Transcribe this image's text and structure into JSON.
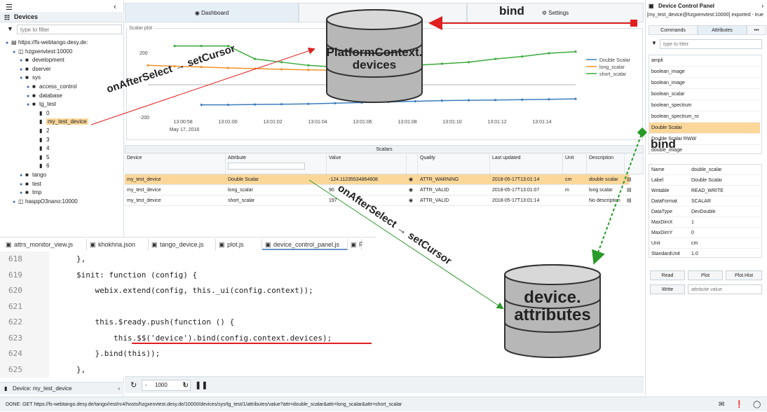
{
  "left": {
    "section_title": "Devices",
    "filter_placeholder": "type to filter",
    "tree": [
      {
        "label": "https://fs-webtango.desy.de:",
        "level": 0,
        "icon": "server-icon"
      },
      {
        "label": "hzgxenvtest:10000",
        "level": 1,
        "icon": "database-icon"
      },
      {
        "label": "development",
        "level": 2,
        "icon": "folder-icon"
      },
      {
        "label": "dserver",
        "level": 2,
        "icon": "folder-icon"
      },
      {
        "label": "sys",
        "level": 2,
        "icon": "folder-icon"
      },
      {
        "label": "access_control",
        "level": 3,
        "icon": "folder-icon"
      },
      {
        "label": "database",
        "level": 3,
        "icon": "folder-icon"
      },
      {
        "label": "tg_test",
        "level": 3,
        "icon": "folder-icon"
      },
      {
        "label": "0",
        "level": 4,
        "icon": "device-icon"
      },
      {
        "label": "my_test_device",
        "level": 4,
        "icon": "device-icon",
        "selected": true
      },
      {
        "label": "2",
        "level": 4,
        "icon": "device-icon"
      },
      {
        "label": "3",
        "level": 4,
        "icon": "device-icon"
      },
      {
        "label": "4",
        "level": 4,
        "icon": "device-icon"
      },
      {
        "label": "5",
        "level": 4,
        "icon": "device-icon"
      },
      {
        "label": "6",
        "level": 4,
        "icon": "device-icon"
      },
      {
        "label": "tango",
        "level": 2,
        "icon": "folder-icon"
      },
      {
        "label": "test",
        "level": 2,
        "icon": "folder-icon"
      },
      {
        "label": "tmp",
        "level": 2,
        "icon": "folder-icon"
      },
      {
        "label": "hasppO3nano:10000",
        "level": 1,
        "icon": "database-icon"
      }
    ],
    "footer": "Device: my_test_device"
  },
  "tabs": {
    "dashboard": "Dashboard",
    "settings": "Settings"
  },
  "plot": {
    "title": "Scalar plot",
    "scalars_bar": "Scalars"
  },
  "chart_data": {
    "type": "line",
    "title": "Scalar plot",
    "x_ticks": [
      "13:00:58",
      "13:01:00",
      "13:01:02",
      "13:01:04",
      "13:01:06",
      "13:01:08",
      "13:01:10",
      "13:01:12",
      "13:01:14"
    ],
    "x_date_label": "May 17, 2018",
    "y_ticks": [
      "200",
      "-200"
    ],
    "ylim": [
      -260,
      260
    ],
    "legend_position": "top-right",
    "series": [
      {
        "name": "Double Scalar",
        "color": "#3b7dbd",
        "points": [
          [
            2,
            -124
          ],
          [
            3,
            -124
          ],
          [
            4,
            -122
          ],
          [
            5,
            -120
          ],
          [
            6,
            -118
          ],
          [
            7,
            -114
          ],
          [
            8,
            -110
          ],
          [
            9,
            -106
          ],
          [
            10,
            -102
          ],
          [
            11,
            -98
          ],
          [
            12,
            -96
          ],
          [
            13,
            -94
          ],
          [
            14,
            -92
          ],
          [
            15,
            -90
          ],
          [
            16,
            -87
          ]
        ]
      },
      {
        "name": "long_scalar",
        "color": "#f0922b",
        "points": [
          [
            0,
            120
          ],
          [
            1,
            115
          ],
          [
            2,
            110
          ],
          [
            3,
            104
          ],
          [
            4,
            100
          ],
          [
            5,
            96
          ],
          [
            6,
            92
          ],
          [
            7,
            90
          ]
        ]
      },
      {
        "name": "short_scalar",
        "color": "#3bab3b",
        "points": [
          [
            1,
            240
          ],
          [
            2,
            240
          ],
          [
            3,
            240
          ],
          [
            4,
            160
          ],
          [
            5,
            140
          ],
          [
            6,
            120
          ],
          [
            7,
            110
          ],
          [
            8,
            115
          ],
          [
            9,
            118
          ],
          [
            10,
            120
          ],
          [
            11,
            130
          ],
          [
            12,
            140
          ],
          [
            13,
            160
          ],
          [
            14,
            175
          ],
          [
            15,
            195
          ],
          [
            16,
            205
          ]
        ]
      }
    ]
  },
  "table": {
    "headers": [
      "Device",
      "Attribute",
      "Value",
      "",
      "Quality",
      "Last updated",
      "Unit",
      "Description"
    ],
    "rows": [
      {
        "device": "my_test_device",
        "attribute": "Double Scalar",
        "value": "-124.11235534864608",
        "quality": "ATTR_WARNING",
        "updated": "2018-05-17T13:01:14",
        "unit": "cm",
        "description": "double scalar",
        "selected": true
      },
      {
        "device": "my_test_device",
        "attribute": "long_scalar",
        "value": "90",
        "quality": "ATTR_VALID",
        "updated": "2018-05-17T13:01:07",
        "unit": "m",
        "description": "long scalar",
        "selected": false
      },
      {
        "device": "my_test_device",
        "attribute": "short_scalar",
        "value": "197",
        "quality": "ATTR_VALID",
        "updated": "2018-05-17T13:01:14",
        "unit": "",
        "description": "No description",
        "selected": false
      }
    ]
  },
  "editor": {
    "tabs": [
      "attrs_monitor_view.js",
      "khokhria.json",
      "tango_device.js",
      "plot.js",
      "device_control_panel.js",
      "F"
    ],
    "active_tab": "device_control_panel.js",
    "lines": [
      {
        "num": "618",
        "text": "        },"
      },
      {
        "num": "619",
        "text": "        $init: function (config) {"
      },
      {
        "num": "620",
        "text": "            webix.extend(config, this._ui(config.context));"
      },
      {
        "num": "621",
        "text": ""
      },
      {
        "num": "622",
        "text": "            this.$ready.push(function () {"
      },
      {
        "num": "623",
        "text": "                this.$$('device').bind(config.context.devices);"
      },
      {
        "num": "624",
        "text": "            }.bind(this));"
      },
      {
        "num": "625",
        "text": "        },"
      }
    ]
  },
  "toolbar": {
    "refresh_value": "1000"
  },
  "right": {
    "title": "Device Control Panel",
    "subtitle": "[my_test_device@hzgxenvtest:10000] exported - true",
    "tabs": [
      "Commands",
      "Attributes"
    ],
    "more": "•••",
    "filter_placeholder": "type to filter",
    "attributes": [
      "ampli",
      "boolean_image",
      "boolean_image",
      "boolean_scalar",
      "boolean_spectrum",
      "boolean_spectrum_ro",
      "Double Scalar",
      "Double Scalar RWW",
      "double_image"
    ],
    "selected_attribute_index": 6,
    "props": [
      {
        "k": "Name",
        "v": "double_scalar"
      },
      {
        "k": "Label",
        "v": "Double Scalar"
      },
      {
        "k": "Writable",
        "v": "READ_WRITE"
      },
      {
        "k": "DataFormat",
        "v": "SCALAR"
      },
      {
        "k": "DataType",
        "v": "DevDouble"
      },
      {
        "k": "MaxDimX",
        "v": "1"
      },
      {
        "k": "MaxDimY",
        "v": "0"
      },
      {
        "k": "Unit",
        "v": "cm"
      },
      {
        "k": "StandardUnit",
        "v": "1.0"
      }
    ],
    "buttons": {
      "read": "Read",
      "plot": "Plot",
      "plot_hist": "Plot.Hist",
      "write": "Write"
    },
    "write_placeholder": "attribute value"
  },
  "status": "DONE: GET https://fs-webtango.desy.de/tango/rest/rc4/hosts/hzgxenvtest.desy.de/10000/devices/sys/tg_test/1/attributes/value?attr=double_scalar&attr=long_scalar&attr=short_scalar",
  "annotations": {
    "bind_top": "bind",
    "bind_right": "bind",
    "on_after_select_1": "onAfterSelect → setCursor",
    "on_after_select_2": "onAfterSelect → setCursor",
    "db_platform": "PlatformContext. devices",
    "db_device": "device. attributes"
  }
}
